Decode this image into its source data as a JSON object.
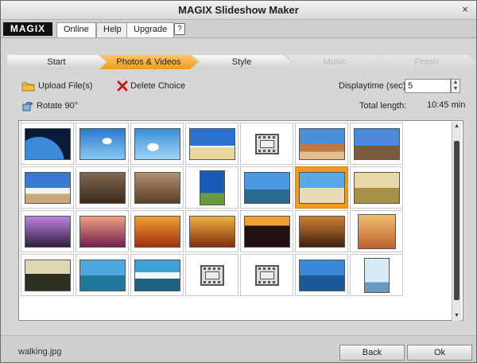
{
  "window": {
    "title": "MAGIX Slideshow Maker",
    "close": "×"
  },
  "menubar": {
    "logo": "MAGIX",
    "items": [
      "Online",
      "Help",
      "Upgrade"
    ],
    "help_icon": "?"
  },
  "steps": [
    {
      "label": "Start",
      "state": "done"
    },
    {
      "label": "Photos & Videos",
      "state": "active"
    },
    {
      "label": "Style",
      "state": "done"
    },
    {
      "label": "Music",
      "state": "disabled"
    },
    {
      "label": "Finish!",
      "state": "disabled"
    }
  ],
  "toolbar": {
    "upload_label": "Upload File(s)",
    "delete_label": "Delete Choice",
    "rotate_label": "Rotate 90°",
    "displaytime_label": "Displaytime (sec):",
    "displaytime_value": "5",
    "total_length_label": "Total length:",
    "total_length_value": "10:45 min"
  },
  "thumbnails": [
    {
      "kind": "photo",
      "scene": "earth"
    },
    {
      "kind": "photo",
      "scene": "sky-clouds"
    },
    {
      "kind": "photo",
      "scene": "sky-clouds2"
    },
    {
      "kind": "photo",
      "scene": "beach-clouds"
    },
    {
      "kind": "video"
    },
    {
      "kind": "photo",
      "scene": "desert-rock"
    },
    {
      "kind": "photo",
      "scene": "horses"
    },
    {
      "kind": "photo",
      "scene": "snow-mountain"
    },
    {
      "kind": "photo",
      "scene": "dusty-riders"
    },
    {
      "kind": "photo",
      "scene": "riders-sepia"
    },
    {
      "kind": "photo",
      "scene": "blue-sky-portrait"
    },
    {
      "kind": "photo",
      "scene": "palms-lake"
    },
    {
      "kind": "photo",
      "scene": "walking",
      "selected": true
    },
    {
      "kind": "photo",
      "scene": "arch-field"
    },
    {
      "kind": "photo",
      "scene": "palm-sunset-purple"
    },
    {
      "kind": "photo",
      "scene": "pink-sunset"
    },
    {
      "kind": "photo",
      "scene": "orange-palms"
    },
    {
      "kind": "photo",
      "scene": "hut-sunset"
    },
    {
      "kind": "photo",
      "scene": "dark-sunset"
    },
    {
      "kind": "photo",
      "scene": "orange-sea"
    },
    {
      "kind": "photo",
      "scene": "golden-sunset"
    },
    {
      "kind": "photo",
      "scene": "palms-reflection"
    },
    {
      "kind": "photo",
      "scene": "tropical-island"
    },
    {
      "kind": "photo",
      "scene": "waves-rocks"
    },
    {
      "kind": "video"
    },
    {
      "kind": "video"
    },
    {
      "kind": "photo",
      "scene": "sailboats"
    },
    {
      "kind": "photo",
      "scene": "lighthouse"
    }
  ],
  "status": {
    "filename": "walking.jpg"
  },
  "buttons": {
    "back": "Back",
    "ok": "Ok"
  },
  "colors": {
    "active_step": "#f39a18",
    "selection": "#f39a18"
  }
}
